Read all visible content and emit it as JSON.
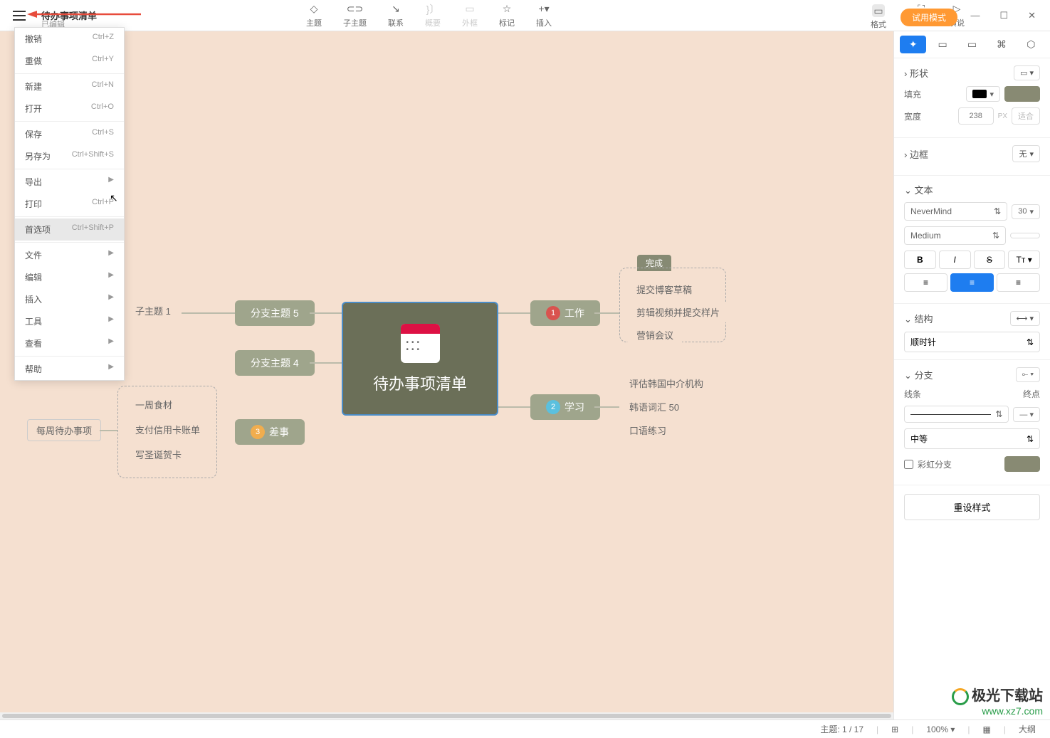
{
  "header": {
    "title": "待办事项清单",
    "subtitle": "已编辑"
  },
  "toolbar": {
    "items": [
      {
        "label": "主题",
        "disabled": false
      },
      {
        "label": "子主题",
        "disabled": false
      },
      {
        "label": "联系",
        "disabled": false
      },
      {
        "label": "概要",
        "disabled": true
      },
      {
        "label": "外框",
        "disabled": true
      },
      {
        "label": "标记",
        "disabled": false
      },
      {
        "label": "插入",
        "disabled": false
      }
    ],
    "right": [
      {
        "label": "ZEN"
      },
      {
        "label": "演说"
      }
    ],
    "format": "格式",
    "trial": "试用模式"
  },
  "menu": {
    "items": [
      {
        "label": "撤销",
        "shortcut": "Ctrl+Z"
      },
      {
        "label": "重做",
        "shortcut": "Ctrl+Y"
      },
      {
        "sep": true
      },
      {
        "label": "新建",
        "shortcut": "Ctrl+N"
      },
      {
        "label": "打开",
        "shortcut": "Ctrl+O"
      },
      {
        "sep": true
      },
      {
        "label": "保存",
        "shortcut": "Ctrl+S"
      },
      {
        "label": "另存为",
        "shortcut": "Ctrl+Shift+S"
      },
      {
        "sep": true
      },
      {
        "label": "导出",
        "submenu": true
      },
      {
        "label": "打印",
        "shortcut": "Ctrl+P"
      },
      {
        "sep": true
      },
      {
        "label": "首选项",
        "shortcut": "Ctrl+Shift+P",
        "highlighted": true
      },
      {
        "sep": true
      },
      {
        "label": "文件",
        "submenu": true
      },
      {
        "label": "编辑",
        "submenu": true
      },
      {
        "label": "插入",
        "submenu": true
      },
      {
        "label": "工具",
        "submenu": true
      },
      {
        "label": "查看",
        "submenu": true
      },
      {
        "sep": true
      },
      {
        "label": "帮助",
        "submenu": true
      }
    ]
  },
  "mindmap": {
    "central": "待办事项清单",
    "done_tag": "完成",
    "branches": {
      "b5": "分支主题 5",
      "b4": "分支主题 4",
      "sub1": "子主题 1",
      "work": "工作",
      "study": "学习",
      "errand": "差事",
      "weekly": "每周待办事项",
      "work_items": [
        "提交博客草稿",
        "剪辑视频并提交样片",
        "营销会议"
      ],
      "study_items": [
        "评估韩国中介机构",
        "韩语词汇 50",
        "口语练习"
      ],
      "errand_items": [
        "一周食材",
        "支付信用卡账单",
        "写圣诞贺卡"
      ]
    }
  },
  "panel": {
    "shape": {
      "title": "形状"
    },
    "fill": {
      "label": "填充"
    },
    "width": {
      "label": "宽度",
      "value": "238",
      "unit": "PX",
      "fit": "适合"
    },
    "border": {
      "title": "边框",
      "value": "无"
    },
    "text": {
      "title": "文本",
      "font": "NeverMind",
      "size": "30",
      "weight": "Medium"
    },
    "structure": {
      "title": "结构",
      "value": "顺时针"
    },
    "branch": {
      "title": "分支",
      "line_label": "线条",
      "end_label": "终点",
      "thickness": "中等",
      "rainbow": "彩虹分支"
    },
    "reset": "重设样式"
  },
  "statusbar": {
    "topic": "主题: 1 / 17",
    "zoom": "100%",
    "outline": "大纲"
  },
  "watermark": {
    "text": "极光下载站",
    "url": "www.xz7.com"
  }
}
